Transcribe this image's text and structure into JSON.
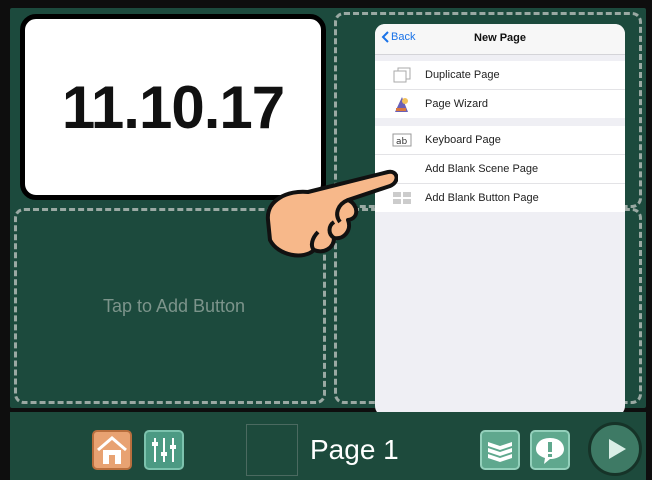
{
  "board": {
    "date_text": "11.10.17",
    "tap_label": "Tap to Add Button"
  },
  "popover": {
    "back_label": "Back",
    "title": "New Page",
    "group1": [
      {
        "label": "Duplicate Page",
        "icon": "duplicate-page-icon"
      },
      {
        "label": "Page Wizard",
        "icon": "wizard-icon"
      }
    ],
    "group2": [
      {
        "label": "Keyboard Page",
        "icon": "keyboard-page-icon"
      },
      {
        "label": "Add Blank Scene Page",
        "icon": "scene-page-icon"
      },
      {
        "label": "Add Blank Button Page",
        "icon": "button-page-icon"
      }
    ]
  },
  "toolbar": {
    "page_label": "Page 1",
    "buttons": [
      "home-icon",
      "settings-sliders-icon",
      "pages-stack-icon",
      "alert-icon",
      "play-icon"
    ]
  },
  "colors": {
    "board_green": "#1c4a3d",
    "accent_blue": "#1a73e8",
    "home_orange": "#e8a272"
  }
}
